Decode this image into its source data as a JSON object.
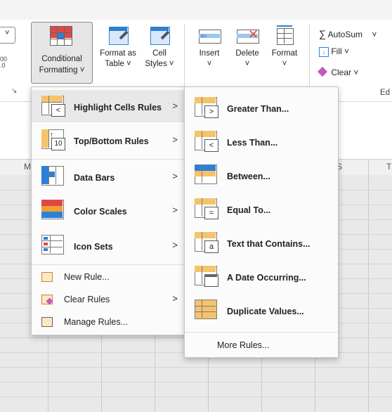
{
  "ribbon": {
    "conditional_formatting": {
      "line1": "Conditional",
      "line2": "Formatting ˅"
    },
    "format_as_table": {
      "line1": "Format as",
      "line2": "Table ˅"
    },
    "cell_styles": {
      "line1": "Cell",
      "line2": "Styles ˅"
    },
    "insert": {
      "line1": "Insert",
      "line2": "˅"
    },
    "delete": {
      "line1": "Delete",
      "line2": "˅"
    },
    "format": {
      "line1": "Format",
      "line2": "˅"
    },
    "autosum": "AutoSum",
    "autosum_glyph": "∑",
    "fill": "Fill ˅",
    "clear": "Clear ˅",
    "editing_group_partial": "Ed",
    "partial_left_top": "˅",
    "partial_left_mid": "00",
    "partial_left_bot": ".0"
  },
  "sheet": {
    "col_m": "M",
    "col_s": "S",
    "col_t": "T"
  },
  "cf_menu": {
    "items": [
      {
        "label": "Highlight Cells Rules",
        "hotkey_index": 0,
        "arrow": ">"
      },
      {
        "label": "Top/Bottom Rules",
        "arrow": ">"
      },
      {
        "label": "Data Bars",
        "arrow": ">"
      },
      {
        "label": "Color Scales",
        "arrow": ">"
      },
      {
        "label": "Icon Sets",
        "arrow": ">"
      }
    ],
    "small_items": [
      {
        "label": "New Rule..."
      },
      {
        "label": "Clear Rules",
        "arrow": ">"
      },
      {
        "label": "Manage Rules..."
      }
    ]
  },
  "highlight_submenu": {
    "items": [
      {
        "label": "Greater Than..."
      },
      {
        "label": "Less Than..."
      },
      {
        "label": "Between..."
      },
      {
        "label": "Equal To..."
      },
      {
        "label": "Text that Contains..."
      },
      {
        "label": "A Date Occurring..."
      },
      {
        "label": "Duplicate Values..."
      }
    ],
    "more_rules": "More Rules..."
  },
  "colors": {
    "accent_red": "#e04848",
    "accent_blue": "#2f7fd6",
    "accent_orange": "#f0a030",
    "hover_bg": "#e8e8e8"
  }
}
